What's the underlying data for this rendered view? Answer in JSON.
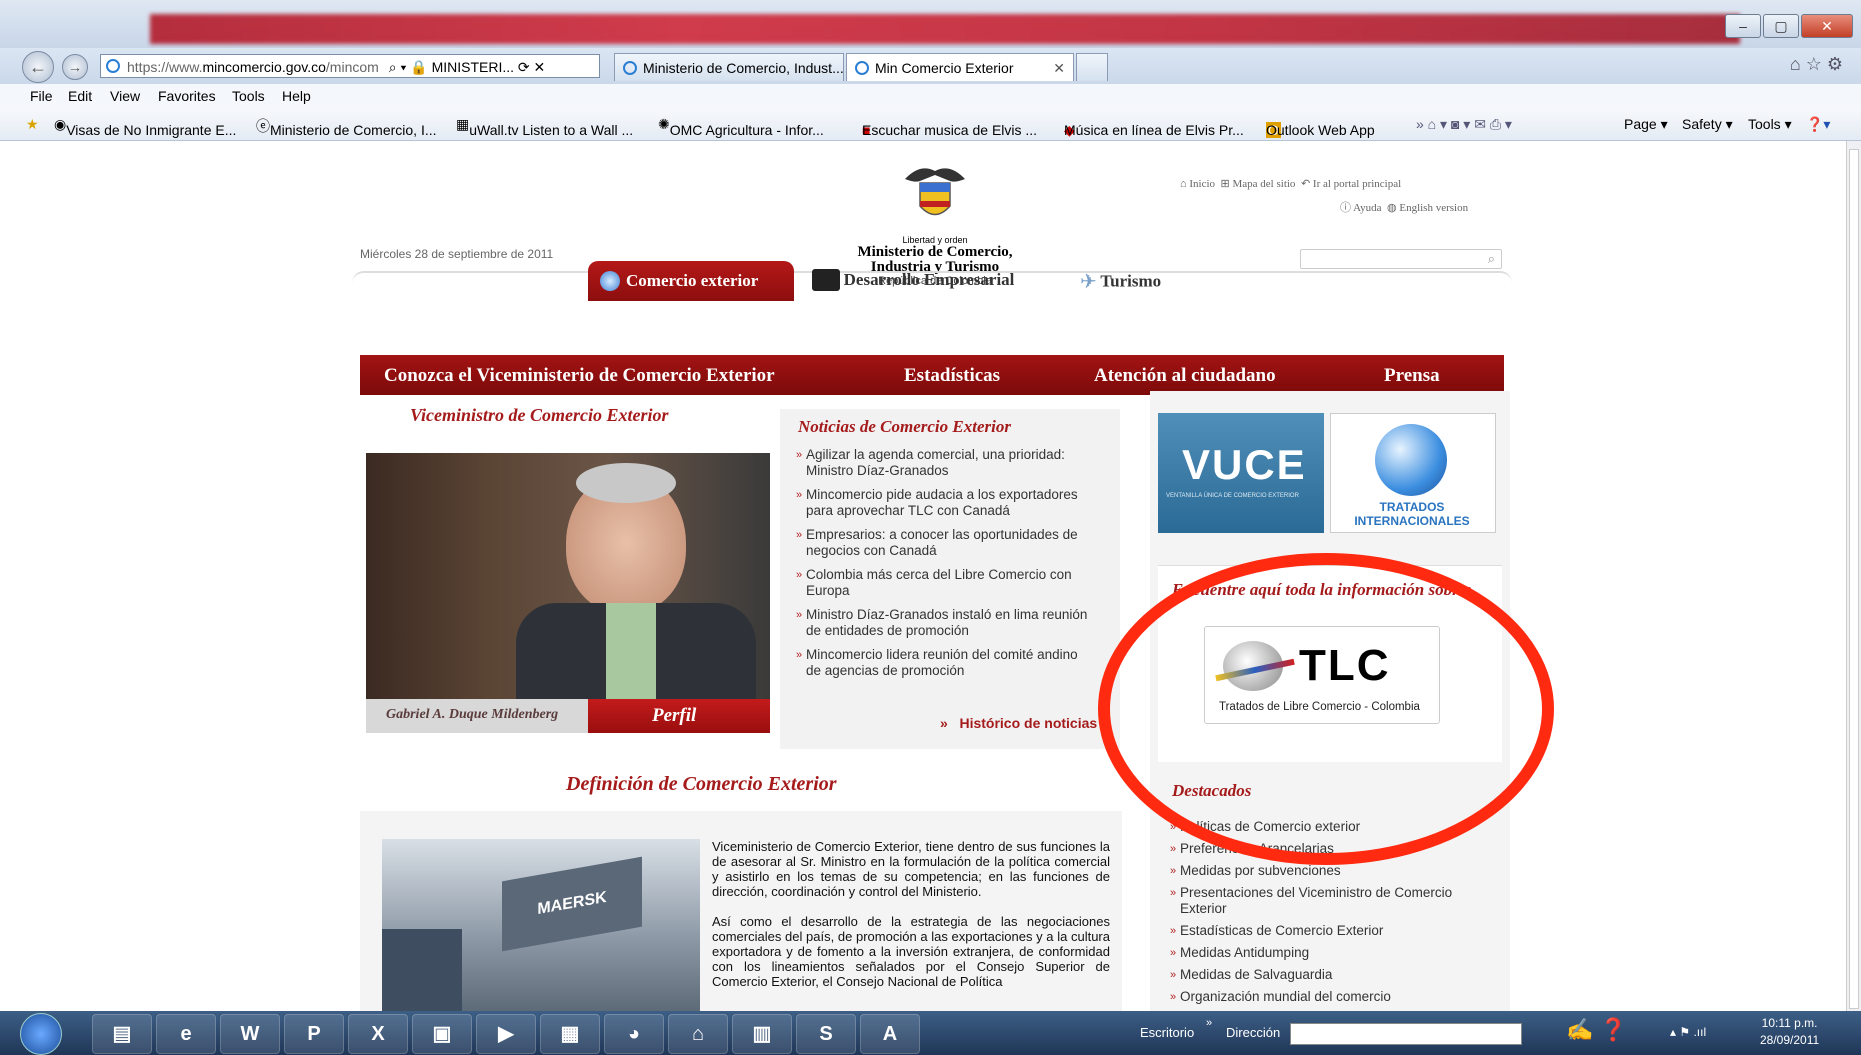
{
  "browser": {
    "address_prefix": "https://www.",
    "address_domain": "mincomercio.gov.co",
    "address_rest": "/mincom",
    "tab_in_addr": "MINISTERI...",
    "tabs": [
      "Ministerio de Comercio, Indust...",
      "Min Comercio Exterior"
    ],
    "menu": [
      "File",
      "Edit",
      "View",
      "Favorites",
      "Tools",
      "Help"
    ],
    "favorites": [
      "Visas de No Inmigrante  E...",
      "Ministerio de Comercio, I...",
      "uWall.tv  Listen to a Wall ...",
      "OMC  Agricultura - Infor...",
      "Escuchar musica de Elvis ...",
      "Música en línea de Elvis Pr...",
      "Outlook Web App"
    ],
    "commands": [
      "Page ▾",
      "Safety ▾",
      "Tools ▾"
    ]
  },
  "page": {
    "date": "Miércoles 28 de septiembre de 2011",
    "motto": "Libertad y orden",
    "ministry_line1": "Ministerio de Comercio,",
    "ministry_line2": "Industria y Turismo",
    "republic": "República de Colombia",
    "top_links": [
      "Inicio",
      "Mapa del sitio",
      "Ir al portal principal"
    ],
    "top_links2": [
      "Ayuda",
      "English version"
    ],
    "tabs": [
      "Comercio exterior",
      "Desarrollo Empresarial",
      "Turismo"
    ],
    "nav": [
      "Conozca el Viceministerio de Comercio Exterior",
      "Estadísticas",
      "Atención al ciudadano",
      "Prensa"
    ],
    "vice_title": "Viceministro de Comercio Exterior",
    "person_name": "Gabriel A. Duque Mildenberg",
    "perfil": "Perfil",
    "news_title": "Noticias de Comercio Exterior",
    "news": [
      "Agilizar la agenda comercial, una prioridad: Ministro Díaz-Granados",
      "Mincomercio pide audacia a los exportadores para aprovechar TLC con Canadá",
      "Empresarios: a conocer las oportunidades de negocios con Canadá",
      "Colombia más cerca del Libre Comercio con Europa",
      "Ministro Díaz-Granados instaló en lima reunión de entidades de promoción",
      "Mincomercio lidera reunión del comité andino de agencias de promoción"
    ],
    "news_history": "Histórico de noticias",
    "def_title": "Definición de Comercio Exterior",
    "def_p1": "Viceministerio de Comercio Exterior, tiene dentro de sus funciones la de asesorar al Sr. Ministro en la formulación de la política comercial y asistirlo en los temas de su competencia; en las funciones de dirección, coordinación y control del Ministerio.",
    "def_p2": "Así como el desarrollo de la estrategia de las negociaciones comerciales del país, de promoción a las exportaciones y a la cultura exportadora y de fomento a la inversión extranjera, de conformidad con los lineamientos señalados por el Consejo Superior de Comercio Exterior, el Consejo Nacional de Política",
    "vuce": "VUCE",
    "vuce_sub": "VENTANILLA ÚNICA DE COMERCIO EXTERIOR",
    "tratados": "TRATADOS INTERNACIONALES",
    "encuentre": "Encuentre aquí toda la información sobre:",
    "tlc": "TLC",
    "tlc_sub": "Tratados de Libre Comercio - Colombia",
    "destacados_title": "Destacados",
    "destacados": [
      "Políticas de Comercio exterior",
      "Preferencias Arancelarias",
      "Medidas por subvenciones",
      "Presentaciones del Viceministro de Comercio Exterior",
      "Estadísticas de Comercio Exterior",
      "Medidas Antidumping",
      "Medidas de Salvaguardia",
      "Organización mundial del comercio"
    ]
  },
  "taskbar": {
    "escritorio": "Escritorio",
    "direccion": "Dirección",
    "time": "10:11 p.m.",
    "date": "28/09/2011"
  }
}
